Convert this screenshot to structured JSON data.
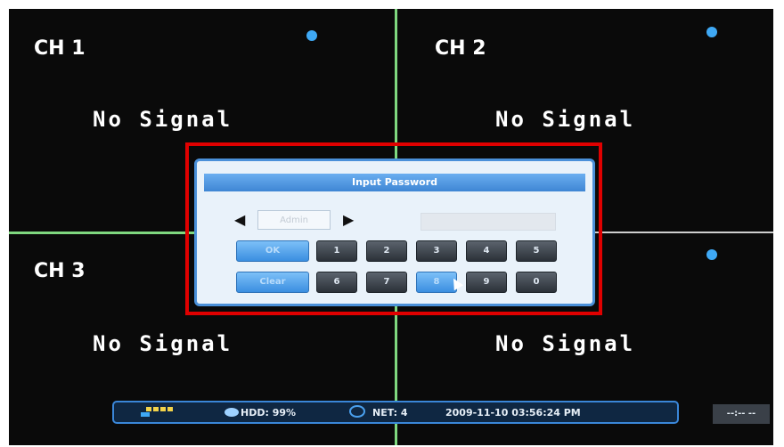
{
  "channels": [
    {
      "label": "CH 1",
      "signal": "No Signal"
    },
    {
      "label": "CH 2",
      "signal": "No Signal"
    },
    {
      "label": "CH 3",
      "signal": "No Signal"
    },
    {
      "label": "",
      "signal": "No Signal"
    }
  ],
  "dialog": {
    "title": "Input Password",
    "user": "Admin",
    "password": "",
    "ok_label": "OK",
    "clear_label": "Clear",
    "keys": [
      "1",
      "2",
      "3",
      "4",
      "5",
      "6",
      "7",
      "8",
      "9",
      "0"
    ]
  },
  "status": {
    "hdd": "HDD: 99%",
    "net": "NET: 4",
    "datetime": "2009-11-10 03:56:24 PM",
    "clock_placeholder": "--:-- --"
  },
  "colors": {
    "grid_line": "#7fd87f",
    "highlight": "#e00000",
    "accent_blue": "#3fa9f5"
  }
}
